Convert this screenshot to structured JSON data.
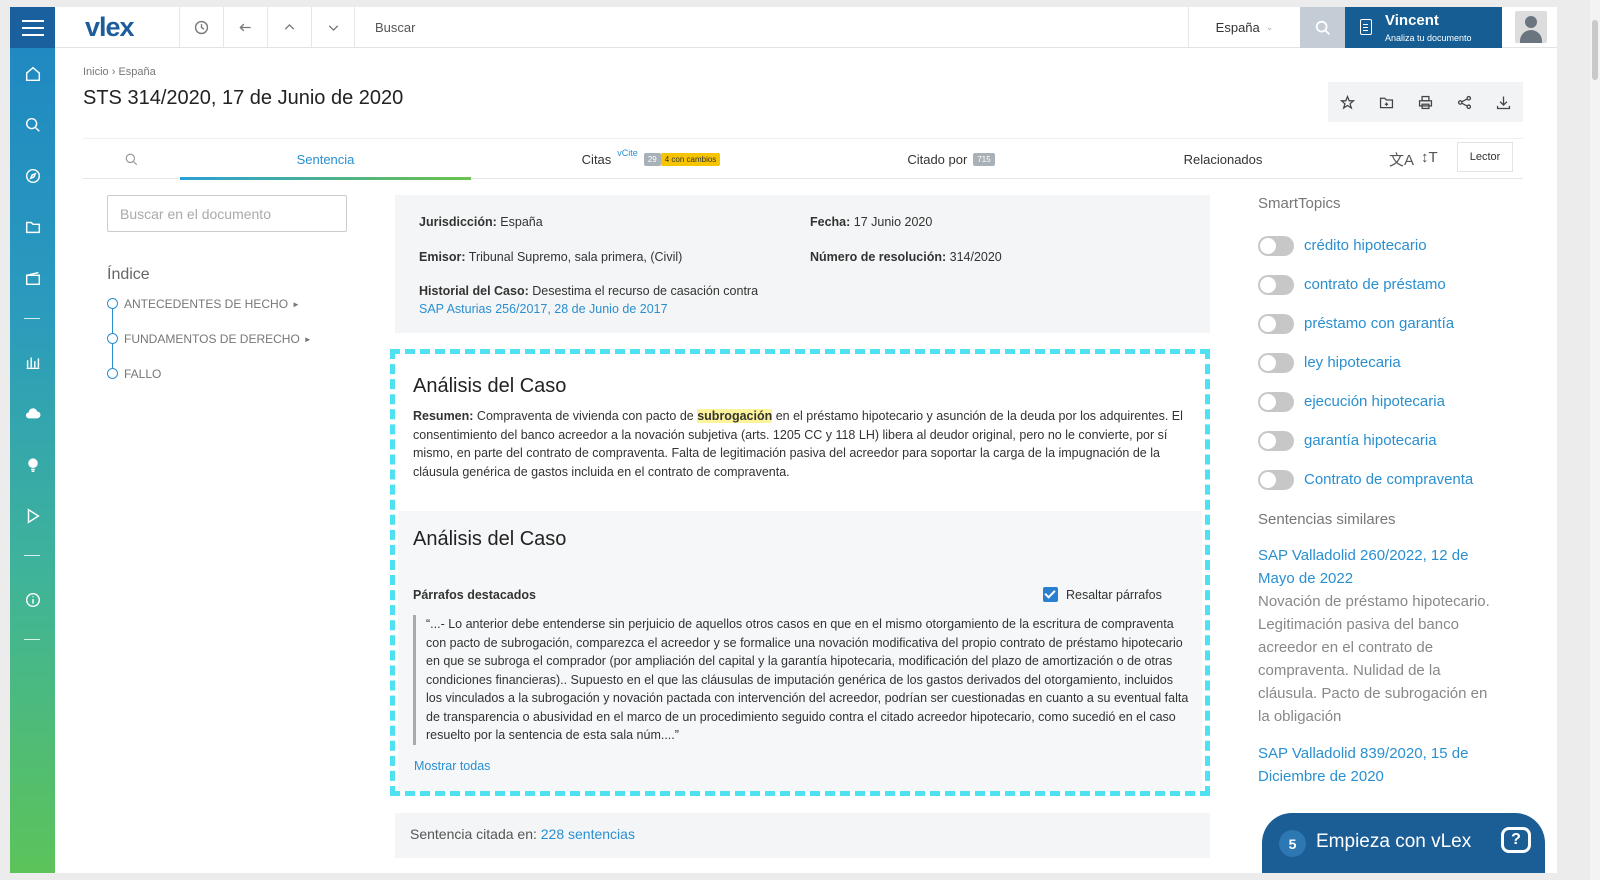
{
  "topbar": {
    "logo_text": "vlex",
    "search_placeholder": "Buscar",
    "country": "España",
    "assistant_name": "Vincent",
    "assistant_sub": "Analiza tu documento"
  },
  "breadcrumb": "Inicio › España",
  "title": "STS 314/2020, 17 de Junio de 2020",
  "tabs": {
    "sentencia": "Sentencia",
    "citas": "Citas",
    "citas_sup": "vCite",
    "citas_count": "29",
    "citas_changes": "4 con cambios",
    "citado_por": "Citado por",
    "citado_count": "715",
    "relacionados": "Relacionados",
    "lector": "Lector"
  },
  "left": {
    "search_placeholder": "Buscar en el documento",
    "indice": "Índice",
    "toc": [
      "ANTECEDENTES DE HECHO",
      "FUNDAMENTOS DE DERECHO",
      "FALLO"
    ]
  },
  "meta": {
    "jurisdiccion_label": "Jurisdicción:",
    "jurisdiccion": "España",
    "fecha_label": "Fecha:",
    "fecha": "17 Junio 2020",
    "emisor_label": "Emisor:",
    "emisor": "Tribunal Supremo, sala primera, (Civil)",
    "resolucion_label": "Número de resolución:",
    "resolucion": "314/2020",
    "historial_label": "Historial del Caso:",
    "historial": "Desestima el recurso de casación contra",
    "historial_link": "SAP Asturias 256/2017, 28 de Junio de 2017"
  },
  "analisis1": {
    "title": "Análisis del Caso",
    "resumen_label": "Resumen:",
    "resumen_pre": "Compraventa de vivienda con pacto de",
    "resumen_hl": "subrogación",
    "resumen_post": "en el préstamo hipotecario y asunción de la deuda por los adquirentes. El consentimiento del banco acreedor a la novación subjetiva (arts. 1205 CC y 118 LH) libera al deudor original, pero no le convierte, por sí mismo, en parte del contrato de compraventa. Falta de legitimación pasiva del acreedor para soportar la carga de la impugnación de la cláusula genérica de gastos incluida en el contrato de compraventa."
  },
  "analisis2": {
    "title": "Análisis del Caso",
    "parrafos": "Párrafos destacados",
    "resaltar": "Resaltar párrafos",
    "quote": "“...- Lo anterior debe entenderse sin perjuicio de aquellos otros casos en que en el mismo otorgamiento de la escritura de compraventa con pacto de subrogación, comparezca el acreedor y se formalice una novación modificativa del propio contrato de préstamo hipotecario en que se subroga el comprador (por ampliación del capital y la garantía hipotecaria, modificación del plazo de amortización o de otras condiciones financieras).. Supuesto en el que las cláusulas de imputación genérica de los gastos derivados del otorgamiento, incluidos los vinculados a la subrogación y novación pactada con intervención del acreedor, podrían ser cuestionadas en cuanto a su eventual falta de transparencia o abusividad en el marco de un procedimiento seguido contra el citado acreedor hipotecario, como sucedió en el caso resuelto por la sentencia de esta sala núm....”",
    "mostrar": "Mostrar todas"
  },
  "citada": {
    "label": "Sentencia citada en:",
    "link": "228 sentencias"
  },
  "right": {
    "smarttopics_title": "SmartTopics",
    "topics": [
      "crédito hipotecario",
      "contrato de préstamo",
      "préstamo con garantía",
      "ley hipotecaria",
      "ejecución hipotecaria",
      "garantía hipotecaria",
      "Contrato de compraventa"
    ],
    "similares_title": "Sentencias similares",
    "similares": [
      {
        "link": "SAP Valladolid 260/2022, 12 de Mayo de 2022",
        "desc": "Novación de préstamo hipotecario. Legitimación pasiva del banco acreedor en el contrato de compraventa. Nulidad de la cláusula. Pacto de subrogación en la obligación"
      },
      {
        "link": "SAP Valladolid 839/2020, 15 de Diciembre de 2020",
        "desc": ""
      }
    ]
  },
  "chat": {
    "count": "5",
    "label": "Empieza con vLex"
  },
  "colors": {
    "brand": "#1d5d9b",
    "link": "#2a8fd0",
    "dash": "#4de1f2",
    "highlight": "#fdf39a"
  }
}
